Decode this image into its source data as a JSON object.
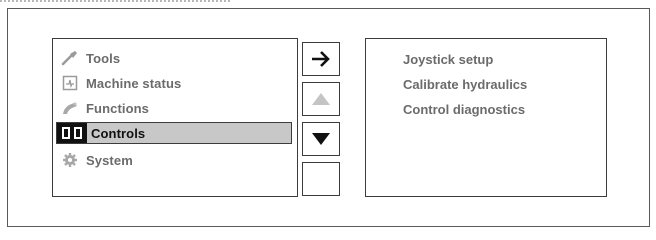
{
  "menu": {
    "items": [
      {
        "label": "Tools",
        "icon": "wrench-icon"
      },
      {
        "label": "Machine status",
        "icon": "machine-status-icon"
      },
      {
        "label": "Functions",
        "icon": "hydraulic-arm-icon"
      },
      {
        "label": "Controls",
        "icon": "controls-icon",
        "selected": true
      },
      {
        "label": "System",
        "icon": "gear-icon"
      }
    ]
  },
  "buttons": {
    "enter": "→",
    "up": "▲",
    "down": "▼",
    "blank": ""
  },
  "submenu": {
    "items": [
      {
        "label": "Joystick setup"
      },
      {
        "label": "Calibrate hydraulics"
      },
      {
        "label": "Control diagnostics"
      }
    ]
  },
  "colors": {
    "selected_bg": "#c8c8c8",
    "text": "#6b6b6b",
    "selected_text": "#111111",
    "border": "#3c3c3c"
  }
}
